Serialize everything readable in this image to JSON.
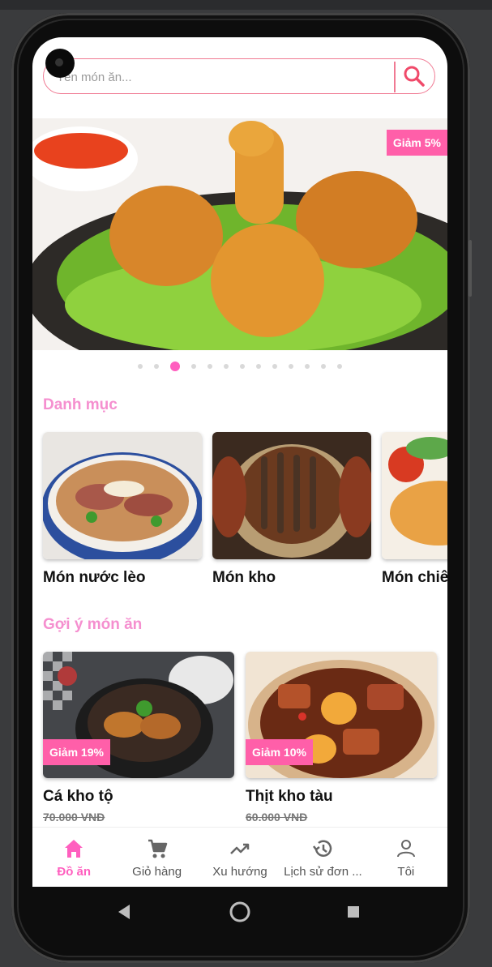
{
  "search": {
    "placeholder": "Tên món ăn..."
  },
  "banner": {
    "badge": "Giảm 5%",
    "dot_count": 13,
    "active_dot": 2
  },
  "categories_section": {
    "title": "Danh mục"
  },
  "categories": [
    {
      "name": "Món nước lèo"
    },
    {
      "name": "Món kho"
    },
    {
      "name": "Món chiên"
    }
  ],
  "suggestions_section": {
    "title": "Gợi ý món ăn"
  },
  "foods": [
    {
      "name": "Cá kho tộ",
      "badge": "Giảm 19%",
      "price": "70.000 VNĐ"
    },
    {
      "name": "Thịt kho tàu",
      "badge": "Giảm 10%",
      "price": "60.000 VNĐ"
    }
  ],
  "bottom_nav": [
    {
      "label": "Đồ ăn",
      "icon": "home-icon",
      "active": true
    },
    {
      "label": "Giỏ hàng",
      "icon": "cart-icon",
      "active": false
    },
    {
      "label": "Xu hướng",
      "icon": "trending-icon",
      "active": false
    },
    {
      "label": "Lịch sử đơn ...",
      "icon": "history-icon",
      "active": false
    },
    {
      "label": "Tôi",
      "icon": "person-icon",
      "active": false
    }
  ],
  "colors": {
    "accent": "#ff5fbf",
    "search_border": "#f07a93",
    "badge": "#ff5fa9",
    "section_title": "#f58fcf"
  }
}
